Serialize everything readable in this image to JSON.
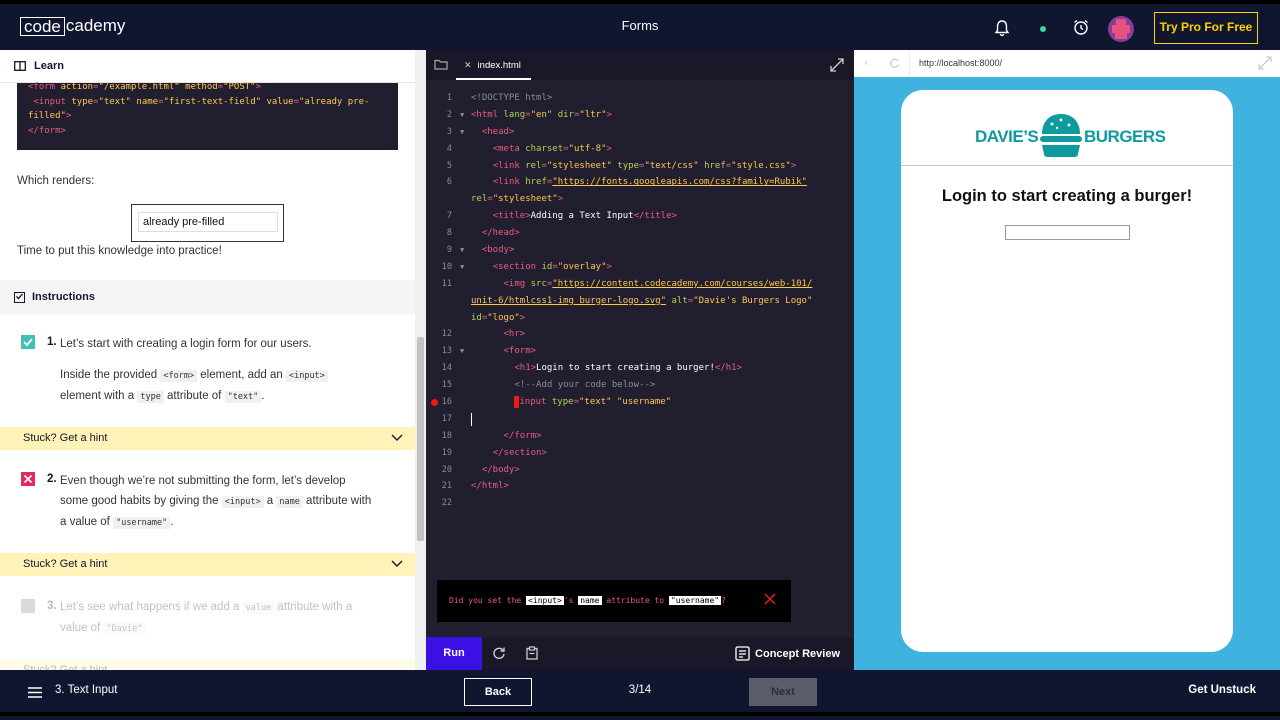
{
  "header": {
    "logo_left": "code",
    "logo_right": "cademy",
    "title": "Forms",
    "pro_button": "Try Pro For Free"
  },
  "learn": {
    "tab_label": "Learn",
    "code_lines": [
      "<form action=\"/example.html\" method=\"POST\">",
      "  <input type=\"text\" name=\"first-text-field\" value=\"already pre-",
      "filled\">",
      "</form>"
    ],
    "renders_label": "Which renders:",
    "prefilled_value": "already pre-filled",
    "practice_text": "Time to put this knowledge into practice!",
    "instructions_label": "Instructions",
    "task1": {
      "num": "1.",
      "text": "Let’s start with creating a login form for our users.",
      "sub_a": "Inside the provided ",
      "code_form": "<form>",
      "sub_b": " element, add an ",
      "code_input": "<input>",
      "sub_c": "element with a ",
      "code_type": "type",
      "sub_d": " attribute of ",
      "code_text": "\"text\"",
      "sub_e": "."
    },
    "hint_label": "Stuck? Get a hint",
    "task2": {
      "num": "2.",
      "line1": "Even though we’re not submitting the form, let’s develop",
      "line2_a": "some good habits by giving the ",
      "code_input": "<input>",
      "line2_b": " a ",
      "code_name": "name",
      "line2_c": " attribute with",
      "line3_a": "a value of ",
      "code_username": "\"username\"",
      "line3_b": "."
    },
    "task3": {
      "num": "3.",
      "line1_a": "Let’s see what happens if we add a ",
      "code_value": "value",
      "line1_b": " attribute with a",
      "line2_a": "value of ",
      "code_davie": "\"Davie\""
    }
  },
  "editor": {
    "filename": "index.html",
    "error": {
      "p1": "Did you set the ",
      "k1": "<input>",
      "p2": "'s ",
      "k2": "name",
      "p3": " attribute to ",
      "k3": "\"username\"",
      "p4": "?"
    },
    "run_label": "Run",
    "concept_label": "Concept Review"
  },
  "browser": {
    "url": "http://localhost:8000/",
    "brand_left": "DAVIE’S",
    "brand_right": "BURGERS",
    "heading": "Login to start creating a burger!"
  },
  "footer": {
    "lesson": "3. Text Input",
    "back": "Back",
    "progress": "3/14",
    "next": "Next",
    "unstuck": "Get Unstuck"
  },
  "colors": {
    "navy": "#10162f",
    "accent_yellow": "#ffd300",
    "run_blue": "#3a10e5",
    "teal": "#0f9aa0",
    "preview_bg": "#3fb2e0"
  }
}
